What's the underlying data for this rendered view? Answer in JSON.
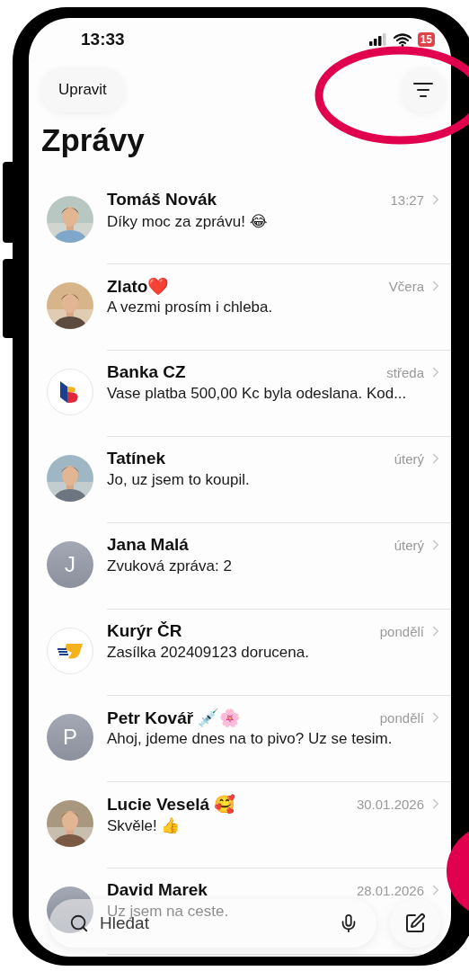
{
  "status_bar": {
    "time": "13:33",
    "battery": "15"
  },
  "header": {
    "edit_button": "Upravit",
    "title": "Zprávy"
  },
  "conversations": [
    {
      "name": "Tomáš Novák",
      "time": "13:27",
      "preview": "Díky moc za zprávu! 😂"
    },
    {
      "name": "Zlato❤️",
      "time": "Včera",
      "preview": "A vezmi prosím i chleba."
    },
    {
      "name": "Banka CZ",
      "time": "středa",
      "preview": "Vase platba 500,00 Kc byla odeslana. Kod...",
      "avatar": {
        "kind": "bank-logo"
      }
    },
    {
      "name": "Tatínek",
      "time": "úterý",
      "preview": "Jo, uz jsem to koupil."
    },
    {
      "name": "Jana Malá",
      "time": "úterý",
      "preview": "Zvuková zpráva: 2",
      "avatar": {
        "kind": "letter",
        "letter": "J"
      }
    },
    {
      "name": "Kurýr ČR",
      "time": "pondělí",
      "preview": "Zasílka 202409123 dorucena.",
      "avatar": {
        "kind": "courier-logo"
      }
    },
    {
      "name": "Petr Kovář 💉🌸",
      "time": "pondělí",
      "preview": "Ahoj, jdeme dnes na to pivo? Uz se tesim.",
      "avatar": {
        "kind": "letter",
        "letter": "P"
      }
    },
    {
      "name": "Lucie Veselá 🥰",
      "time": "30.01.2026",
      "preview": "Skvěle! 👍"
    },
    {
      "name": "David Marek",
      "time": "28.01.2026",
      "preview": "Uz jsem na ceste.",
      "avatar": {
        "kind": "plain"
      }
    }
  ],
  "search": {
    "placeholder": "Hledat"
  },
  "annotations": [
    {
      "kind": "ellipse"
    },
    {
      "kind": "dot"
    }
  ]
}
